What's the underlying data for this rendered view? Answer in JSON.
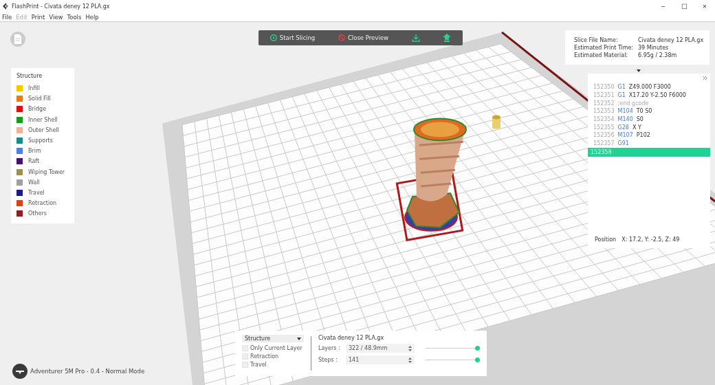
{
  "window": {
    "title": "FlashPrint - Civata deney 12 PLA.gx",
    "controls": [
      "−",
      "☐",
      "×"
    ]
  },
  "menu": [
    {
      "label": "File",
      "disabled": false
    },
    {
      "label": "Edit",
      "disabled": true
    },
    {
      "label": "Print",
      "disabled": false
    },
    {
      "label": "View",
      "disabled": false
    },
    {
      "label": "Tools",
      "disabled": false
    },
    {
      "label": "Help",
      "disabled": false
    }
  ],
  "toolbar": [
    {
      "kind": "slice",
      "label": "Start Slicing"
    },
    {
      "kind": "close",
      "label": "Close Preview"
    },
    {
      "kind": "export"
    },
    {
      "kind": "print"
    }
  ],
  "legend": {
    "title": "Structure",
    "items": [
      {
        "label": "Infill",
        "color": "#f5c800"
      },
      {
        "label": "Solid Fill",
        "color": "#f07a10"
      },
      {
        "label": "Bridge",
        "color": "#e01010"
      },
      {
        "label": "Inner Shell",
        "color": "#1a9a1a"
      },
      {
        "label": "Outer Shell",
        "color": "#f5b090"
      },
      {
        "label": "Supports",
        "color": "#1a8a8a"
      },
      {
        "label": "Brim",
        "color": "#4a80f0"
      },
      {
        "label": "Raft",
        "color": "#4a1070"
      },
      {
        "label": "Wiping Tower",
        "color": "#9a9050"
      },
      {
        "label": "Wall",
        "color": "#a0a0a0"
      },
      {
        "label": "Travel",
        "color": "#1a1a90"
      },
      {
        "label": "Retraction",
        "color": "#e04010"
      },
      {
        "label": "Others",
        "color": "#902020"
      }
    ]
  },
  "slice_info": [
    {
      "label": "Slice File Name:",
      "value": "Civata deney 12 PLA.gx"
    },
    {
      "label": "Estimated Print Time:",
      "value": "39 Minutes"
    },
    {
      "label": "Estimated Material:",
      "value": "6.95g / 2.38m"
    }
  ],
  "gcode": {
    "lines": [
      {
        "kind": "command",
        "number": "152350",
        "command": "G1",
        "args": "Z49.000 F3000",
        "selected": false
      },
      {
        "kind": "command",
        "number": "152351",
        "command": "G1",
        "args": "X17.20 Y-2.50 F6000",
        "selected": false
      },
      {
        "kind": "comment",
        "number": "152352",
        "text": ";end gcode",
        "selected": false
      },
      {
        "kind": "command",
        "number": "152353",
        "command": "M104",
        "args": "T0 S0",
        "selected": false
      },
      {
        "kind": "command",
        "number": "152354",
        "command": "M140",
        "args": "S0",
        "selected": false
      },
      {
        "kind": "command",
        "number": "152355",
        "command": "G28",
        "args": "X Y",
        "selected": false
      },
      {
        "kind": "command",
        "number": "152356",
        "command": "M107",
        "args": "P102",
        "selected": false
      },
      {
        "kind": "command",
        "number": "152357",
        "command": "G91",
        "selected": false
      },
      {
        "kind": "command",
        "number": "152358",
        "selected": true
      }
    ],
    "position_label": "Position",
    "position": "X: 17.2, Y: -2.5, Z: 49"
  },
  "bottom_panel": {
    "view_select": "Structure",
    "options": [
      {
        "label": "Only Current Layer",
        "checked": false
      },
      {
        "label": "Retraction",
        "checked": false
      },
      {
        "label": "Travel",
        "checked": false
      }
    ],
    "file_name": "Civata deney 12 PLA.gx",
    "controls": [
      {
        "label": "Layers :",
        "value": "322 / 48.9mm",
        "level": 1
      },
      {
        "label": "Steps :",
        "value": "141",
        "level": 1
      }
    ]
  },
  "status": "Adventurer 5M Pro - 0.4 - Normal Mode"
}
